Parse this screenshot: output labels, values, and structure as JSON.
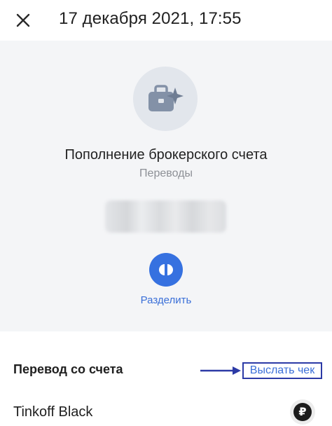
{
  "header": {
    "datetime": "17 декабря 2021, 17:55",
    "close_icon": "close-icon"
  },
  "operation": {
    "category_icon": "briefcase-sparkle-icon",
    "title": "Пополнение брокерского счета",
    "category": "Переводы",
    "split_icon": "split-icon",
    "split_label": "Разделить"
  },
  "details": {
    "section_title": "Перевод со счета",
    "receipt_link": "Выслать чек",
    "account_name": "Tinkoff Black",
    "currency_symbol": "₽",
    "currency_icon": "ruble-icon"
  },
  "colors": {
    "accent": "#3671e0",
    "link": "#3a6fd8",
    "summary_bg": "#f4f5f7",
    "annotation": "#2c3aa6"
  }
}
